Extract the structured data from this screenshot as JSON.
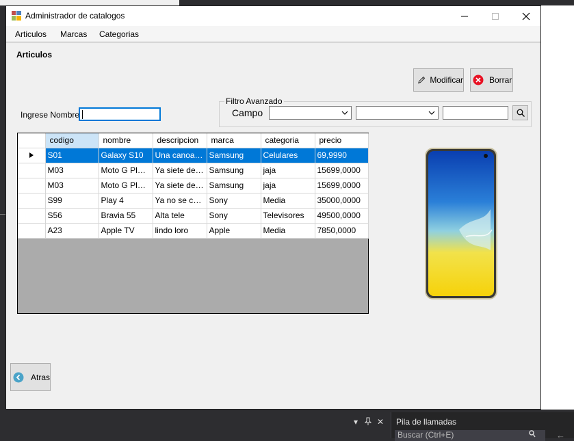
{
  "window": {
    "title": "Administrador de catalogos",
    "minimize": "—",
    "maximize": "☐",
    "close": "✕"
  },
  "menu": [
    "Articulos",
    "Marcas",
    "Categorias"
  ],
  "section_title": "Articulos",
  "buttons": {
    "modificar": "Modificar",
    "borrar": "Borrar",
    "atras": "Atras"
  },
  "search": {
    "label": "Ingrese Nombre",
    "value": ""
  },
  "filtro": {
    "group_title": "Filtro Avanzado",
    "campo_label": "Campo",
    "campo_value": "",
    "criterio_value": "",
    "filtro_value": ""
  },
  "grid": {
    "columns": [
      "codigo",
      "nombre",
      "descripcion",
      "marca",
      "categoria",
      "precio"
    ],
    "rows": [
      [
        "S01",
        "Galaxy S10",
        "Una canoa c...",
        "Samsung",
        "Celulares",
        "69,9990"
      ],
      [
        "M03",
        "Moto G Play ...",
        "Ya siete de e...",
        "Samsung",
        "jaja",
        "15699,0000"
      ],
      [
        "M03",
        "Moto G Play ...",
        "Ya siete de e...",
        "Samsung",
        "jaja",
        "15699,0000"
      ],
      [
        "S99",
        "Play 4",
        "Ya no se cu...",
        "Sony",
        "Media",
        "35000,0000"
      ],
      [
        "S56",
        "Bravia 55",
        "Alta tele",
        "Sony",
        "Televisores",
        "49500,0000"
      ],
      [
        "A23",
        "Apple TV",
        "lindo loro",
        "Apple",
        "Media",
        "7850,0000"
      ]
    ],
    "selected_row": 0
  },
  "ide": {
    "pane_title": "Pila de llamadas",
    "search_placeholder": "Buscar (Ctrl+E)"
  },
  "colors": {
    "selection": "#0078d7",
    "sorted_header": "#cce4f7",
    "grid_background": "#ababab",
    "delete_icon": "#e81123",
    "back_icon": "#4aa3c8"
  }
}
